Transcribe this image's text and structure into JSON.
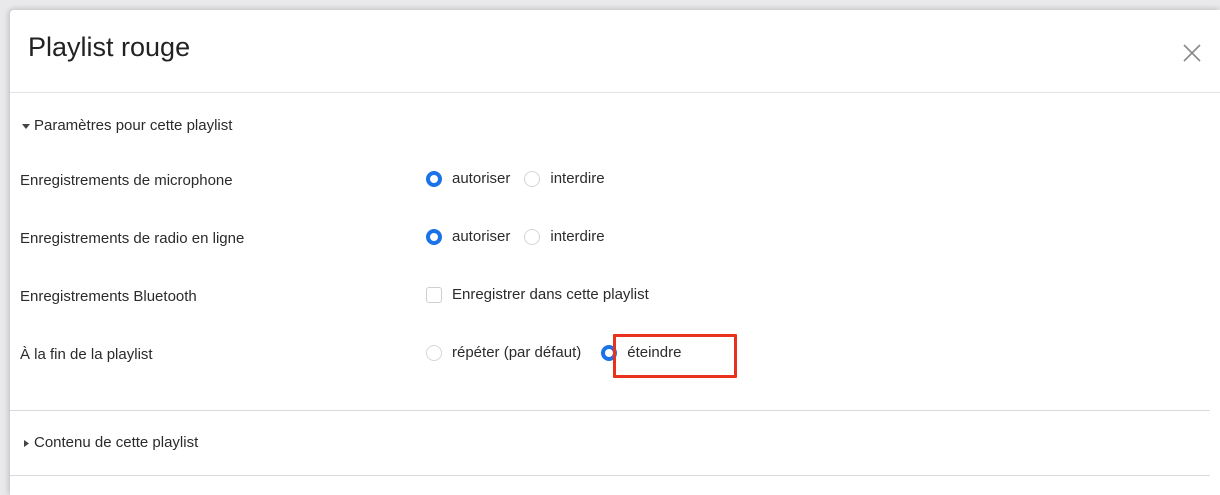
{
  "dialog": {
    "title": "Playlist rouge"
  },
  "settings_section": {
    "label": "Paramètres pour cette playlist",
    "expanded": true
  },
  "rows": {
    "microphone": {
      "label": "Enregistrements de microphone",
      "options": [
        {
          "label": "autoriser",
          "selected": true
        },
        {
          "label": "interdire",
          "selected": false
        }
      ]
    },
    "web_radio": {
      "label": "Enregistrements de radio en ligne",
      "options": [
        {
          "label": "autoriser",
          "selected": true
        },
        {
          "label": "interdire",
          "selected": false
        }
      ]
    },
    "bluetooth": {
      "label": "Enregistrements Bluetooth",
      "checkbox": {
        "label": "Enregistrer dans cette playlist",
        "checked": false
      }
    },
    "end_of_playlist": {
      "label": "À la fin de la playlist",
      "options": [
        {
          "label": "répéter (par défaut)",
          "selected": false
        },
        {
          "label": "éteindre",
          "selected": true
        }
      ]
    }
  },
  "content_section": {
    "label": "Contenu de cette playlist",
    "expanded": false
  },
  "colors": {
    "accent": "#1a73e8",
    "highlight": "#e8321e"
  },
  "icons": {
    "close": "close-icon",
    "expanded": "caret-down-icon",
    "collapsed": "caret-right-icon"
  }
}
